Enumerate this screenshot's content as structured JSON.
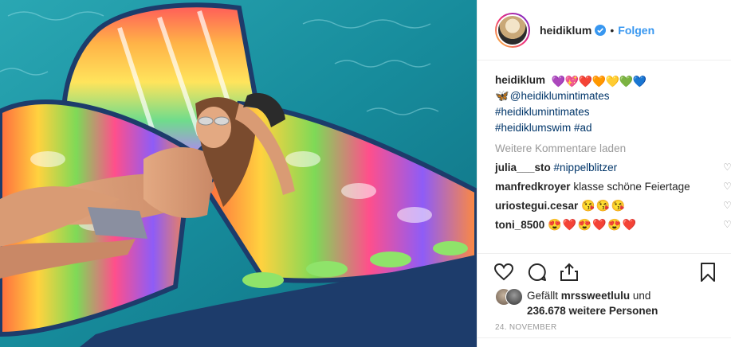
{
  "header": {
    "username": "heidiklum",
    "separator": "•",
    "follow_label": "Folgen"
  },
  "caption": {
    "username": "heidiklum",
    "emojis": [
      "💜",
      "💖",
      "❤️",
      "🧡",
      "💛",
      "💚",
      "💙"
    ],
    "line2_emoji": "🦋",
    "line2_link": "@heidiklumintimates",
    "line3": "#heidiklumintimates",
    "line4": "#heidiklumswim #ad"
  },
  "load_more": "Weitere Kommentare laden",
  "comments": [
    {
      "user": "julia___sto",
      "text": "#nippelblitzer",
      "text_is_link": true
    },
    {
      "user": "manfredkroyer",
      "text": "klasse schöne Feiertage",
      "text_is_link": false
    },
    {
      "user": "uriostegui.cesar",
      "emojis": [
        "😘",
        "😘",
        "😘"
      ]
    },
    {
      "user": "toni_8500",
      "emojis": [
        "😍",
        "❤️",
        "😍",
        "❤️",
        "😍",
        "❤️"
      ]
    }
  ],
  "actions": {
    "like": "heart-outline-icon",
    "comment": "comment-icon",
    "share": "share-icon",
    "save": "bookmark-icon"
  },
  "likes": {
    "prefix": "Gefällt ",
    "user": "mrssweetlulu",
    "middle": " und",
    "count": "236.678 weitere Personen"
  },
  "date": "24. NOVEMBER",
  "colors": {
    "link": "#003569",
    "follow": "#3897f0",
    "muted": "#999999",
    "water": "#1c8fa0"
  }
}
